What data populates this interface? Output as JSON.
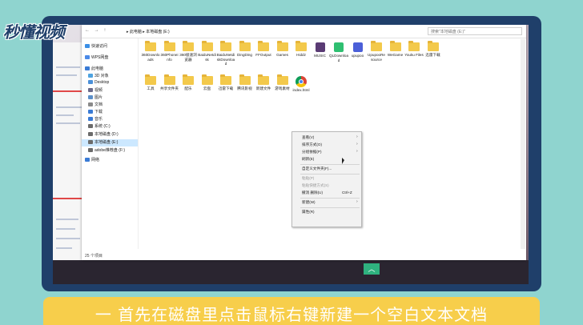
{
  "logo": {
    "text": "秒懂视频"
  },
  "explorer": {
    "nav_arrows": "← → ↑",
    "breadcrumb": "▸ 此电脑 ▸ 本地磁盘 (E:)",
    "search_placeholder": "搜索\"本地磁盘 (E:)\""
  },
  "navpane": {
    "items": [
      {
        "label": "快速访问",
        "icon": "star-icon",
        "color": "#3b8fe6"
      },
      {
        "label": "WPS网盘",
        "icon": "cloud-icon",
        "color": "#4a8ae8"
      },
      {
        "label": "此电脑",
        "icon": "computer-icon",
        "color": "#3a7bd5"
      },
      {
        "label": "3D 对象",
        "icon": "cube-icon",
        "color": "#4fa3e0"
      },
      {
        "label": "Desktop",
        "icon": "desktop-icon",
        "color": "#4a90d9"
      },
      {
        "label": "视频",
        "icon": "video-icon",
        "color": "#6a6a8a"
      },
      {
        "label": "图片",
        "icon": "picture-icon",
        "color": "#5b8fc9"
      },
      {
        "label": "文档",
        "icon": "document-icon",
        "color": "#8a8a8a"
      },
      {
        "label": "下载",
        "icon": "download-icon",
        "color": "#3a7bd5"
      },
      {
        "label": "音乐",
        "icon": "music-icon",
        "color": "#3a7bd5"
      },
      {
        "label": "系统 (C:)",
        "icon": "drive-icon",
        "color": "#6b6b6b"
      },
      {
        "label": "本地磁盘 (D:)",
        "icon": "drive-icon",
        "color": "#6b6b6b"
      },
      {
        "label": "本地磁盘 (E:)",
        "icon": "drive-icon",
        "color": "#6b6b6b"
      },
      {
        "label": "adobe推荐盘 (F:)",
        "icon": "drive-icon",
        "color": "#6b6b6b"
      },
      {
        "label": "网络",
        "icon": "network-icon",
        "color": "#3a7bd5"
      }
    ]
  },
  "files_row1": [
    {
      "name": "360Downloads",
      "kind": "folder"
    },
    {
      "name": "360Phoneinfo",
      "kind": "folder"
    },
    {
      "name": "360极速浏览器",
      "kind": "folder"
    },
    {
      "name": "BaiduNetdisk",
      "kind": "folder"
    },
    {
      "name": "BaiduNetdiskDownload",
      "kind": "folder"
    },
    {
      "name": "DingDing",
      "kind": "folder"
    },
    {
      "name": "FFOutput",
      "kind": "folder"
    },
    {
      "name": "Games",
      "kind": "folder"
    },
    {
      "name": "Hiddz",
      "kind": "folder"
    },
    {
      "name": "MUSIC",
      "kind": "app",
      "color": "#5a3b74"
    },
    {
      "name": "QLDownload",
      "kind": "app",
      "color": "#2fbf71"
    },
    {
      "name": "upupoo",
      "kind": "app",
      "color": "#4b5fd8"
    },
    {
      "name": "UpupooResource",
      "kind": "folder"
    },
    {
      "name": "WeGame",
      "kind": "folder"
    },
    {
      "name": "Youku Files",
      "kind": "folder"
    },
    {
      "name": "迅雷下载",
      "kind": "folder"
    }
  ],
  "files_row2": [
    {
      "name": "工具",
      "kind": "folder"
    },
    {
      "name": "共享文件夹",
      "kind": "folder"
    },
    {
      "name": "配乐",
      "kind": "folder"
    },
    {
      "name": "云盘",
      "kind": "folder"
    },
    {
      "name": "迅雷下载",
      "kind": "folder"
    },
    {
      "name": "腾讯影视",
      "kind": "folder"
    },
    {
      "name": "新建文件",
      "kind": "folder"
    },
    {
      "name": "游戏素材",
      "kind": "folder"
    },
    {
      "name": "index.html",
      "kind": "chrome"
    }
  ],
  "status": {
    "count": "25 个项目"
  },
  "context_menu": {
    "items": [
      {
        "label": "查看(V)",
        "arrow": "›",
        "disabled": false,
        "shortcut": ""
      },
      {
        "label": "排序方式(O)",
        "arrow": "›",
        "disabled": false,
        "shortcut": ""
      },
      {
        "label": "分组依据(P)",
        "arrow": "›",
        "disabled": false,
        "shortcut": ""
      },
      {
        "label": "刷新(E)",
        "arrow": "",
        "disabled": false,
        "shortcut": ""
      },
      {
        "label": "自定义文件夹(F)...",
        "arrow": "",
        "disabled": false,
        "shortcut": ""
      },
      {
        "label": "粘贴(P)",
        "arrow": "",
        "disabled": true,
        "shortcut": ""
      },
      {
        "label": "粘贴快捷方式(S)",
        "arrow": "",
        "disabled": true,
        "shortcut": ""
      },
      {
        "label": "撤消 删除(U)",
        "arrow": "",
        "disabled": false,
        "shortcut": "Ctrl+Z"
      },
      {
        "label": "新建(W)",
        "arrow": "›",
        "disabled": false,
        "shortcut": ""
      },
      {
        "label": "属性(R)",
        "arrow": "",
        "disabled": false,
        "shortcut": ""
      }
    ]
  },
  "subtitle": {
    "text": "一 首先在磁盘里点击鼠标右键新建一个空白文本文档"
  },
  "scroll_up": {
    "glyph": "︿"
  }
}
